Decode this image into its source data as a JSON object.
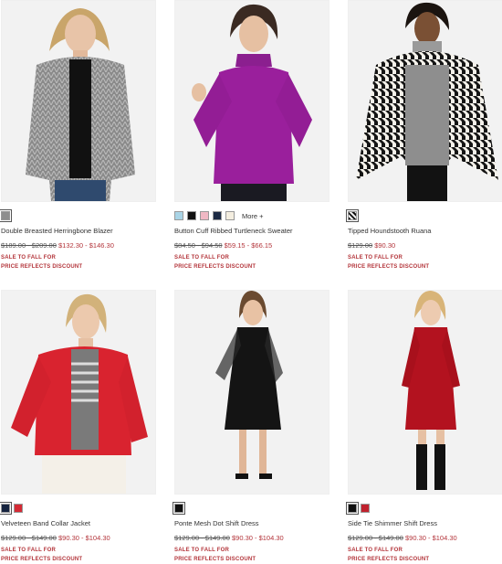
{
  "products": [
    {
      "name": "Double Breasted Herringbone Blazer",
      "original_price": "$189.00 - $209.00",
      "sale_price": "$132.30 - $146.30",
      "promo_line1": "SALE TO FALL FOR",
      "promo_line2": "PRICE REFLECTS DISCOUNT",
      "swatches": [
        "#8e8e8e"
      ],
      "more_label": ""
    },
    {
      "name": "Button Cuff Ribbed Turtleneck Sweater",
      "original_price": "$84.50 - $94.50",
      "sale_price": "$59.15 - $66.15",
      "promo_line1": "SALE TO FALL FOR",
      "promo_line2": "PRICE REFLECTS DISCOUNT",
      "swatches": [
        "#a9d4e6",
        "#111111",
        "#f0b8c4",
        "#1c2a44",
        "#f4eee0"
      ],
      "more_label": "More +"
    },
    {
      "name": "Tipped Houndstooth Ruana",
      "original_price": "$129.00",
      "sale_price": "$90.30",
      "promo_line1": "SALE TO FALL FOR",
      "promo_line2": "PRICE REFLECTS DISCOUNT",
      "swatches": [
        "houndstooth"
      ],
      "more_label": ""
    },
    {
      "name": "Velveteen Band Collar Jacket",
      "original_price": "$129.00 - $149.00",
      "sale_price": "$90.30 - $104.30",
      "promo_line1": "SALE TO FALL FOR",
      "promo_line2": "PRICE REFLECTS DISCOUNT",
      "swatches": [
        "#15233f",
        "#d42a35"
      ],
      "more_label": ""
    },
    {
      "name": "Ponte Mesh Dot Shift Dress",
      "original_price": "$129.00 - $149.00",
      "sale_price": "$90.30 - $104.30",
      "promo_line1": "SALE TO FALL FOR",
      "promo_line2": "PRICE REFLECTS DISCOUNT",
      "swatches": [
        "#111111"
      ],
      "more_label": ""
    },
    {
      "name": "Side Tie Shimmer Shift Dress",
      "original_price": "$129.00 - $149.00",
      "sale_price": "$90.30 - $104.30",
      "promo_line1": "SALE TO FALL FOR",
      "promo_line2": "PRICE REFLECTS DISCOUNT",
      "swatches": [
        "#111111",
        "#c0222e"
      ],
      "more_label": ""
    }
  ]
}
